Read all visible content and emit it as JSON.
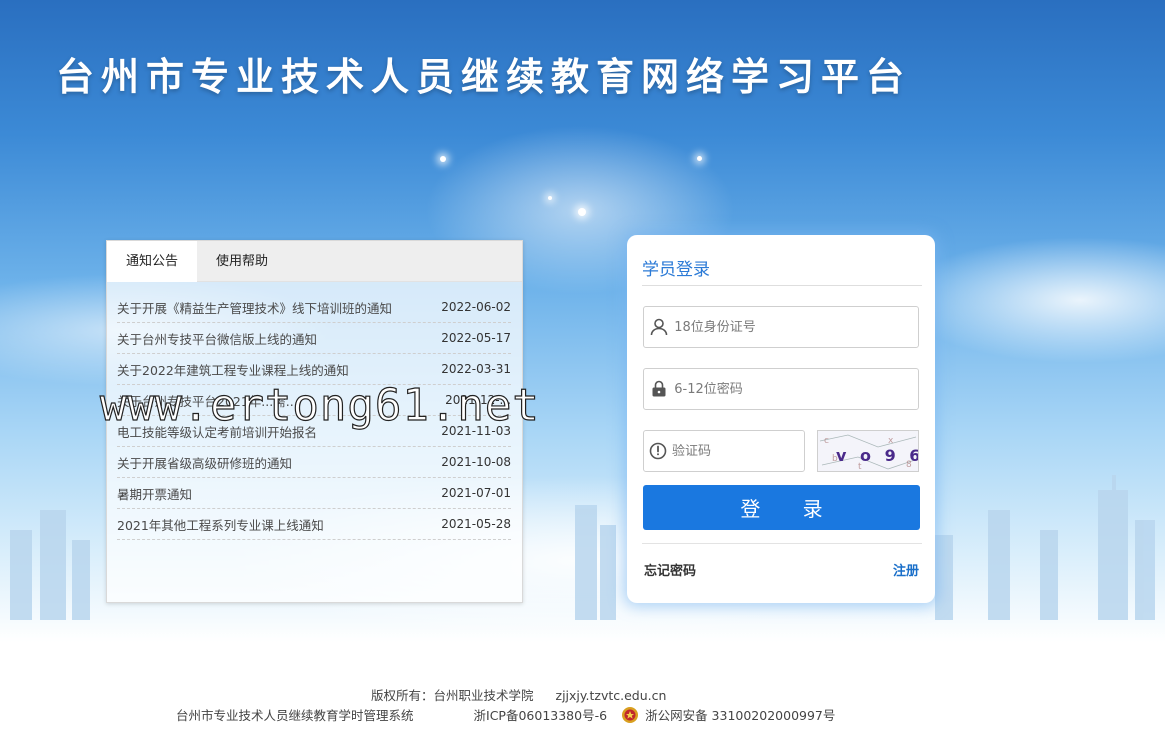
{
  "site": {
    "title": "台州市专业技术人员继续教育网络学习平台"
  },
  "notices": {
    "tabs": [
      {
        "label": "通知公告"
      },
      {
        "label": "使用帮助"
      }
    ],
    "items": [
      {
        "title": "关于开展《精益生产管理技术》线下培训班的通知",
        "date": "2022-06-02"
      },
      {
        "title": "关于台州专技平台微信版上线的通知",
        "date": "2022-05-17"
      },
      {
        "title": "关于2022年建筑工程专业课程上线的通知",
        "date": "2022-03-31"
      },
      {
        "title": "关于台州专技平台2021年...需...",
        "date": "2021-12-..."
      },
      {
        "title": "电工技能等级认定考前培训开始报名",
        "date": "2021-11-03"
      },
      {
        "title": "关于开展省级高级研修班的通知",
        "date": "2021-10-08"
      },
      {
        "title": "暑期开票通知",
        "date": "2021-07-01"
      },
      {
        "title": "2021年其他工程系列专业课上线通知",
        "date": "2021-05-28"
      }
    ]
  },
  "login": {
    "title": "学员登录",
    "id_placeholder": "18位身份证号",
    "password_placeholder": "6-12位密码",
    "captcha_placeholder": "验证码",
    "captcha_text": "v o 9 6",
    "submit_label": "登 录",
    "forgot_label": "忘记密码",
    "register_label": "注册"
  },
  "watermark": {
    "text": "www.ertong61.net"
  },
  "footer": {
    "copyright": "版权所有：台州职业技术学院",
    "url": "zjjxjy.tzvtc.edu.cn",
    "system_name": "台州市专业技术人员继续教育学时管理系统",
    "icp": "浙ICP备06013380号-6",
    "police_record": "浙公网安备 33100202000997号"
  },
  "colors": {
    "accent": "#1a78e0",
    "login_title": "#2b7ad6",
    "register_link": "#1a6fc9"
  }
}
